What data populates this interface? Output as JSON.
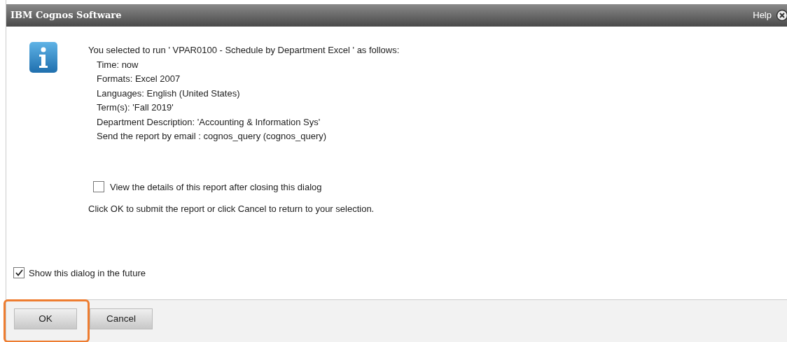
{
  "window": {
    "title": "IBM Cognos Software",
    "help": "Help"
  },
  "message": {
    "intro": "You selected to run ' VPAR0100 - Schedule by Department Excel ' as follows:",
    "details": [
      "Time: now",
      "Formats: Excel 2007",
      "Languages: English (United States)",
      "Term(s):  'Fall 2019'",
      "Department Description:  'Accounting & Information Sys'",
      "Send the report by email : cognos_query (cognos_query)"
    ]
  },
  "view_details": {
    "label": "View the details of this report after closing this dialog",
    "checked": false
  },
  "instruction": "Click OK to submit the report or click Cancel to return to your selection.",
  "show_dialog": {
    "label": "Show this dialog in the future",
    "checked": true
  },
  "buttons": [
    {
      "label": "OK",
      "highlighted": true
    },
    {
      "label": "Cancel",
      "highlighted": false
    }
  ]
}
